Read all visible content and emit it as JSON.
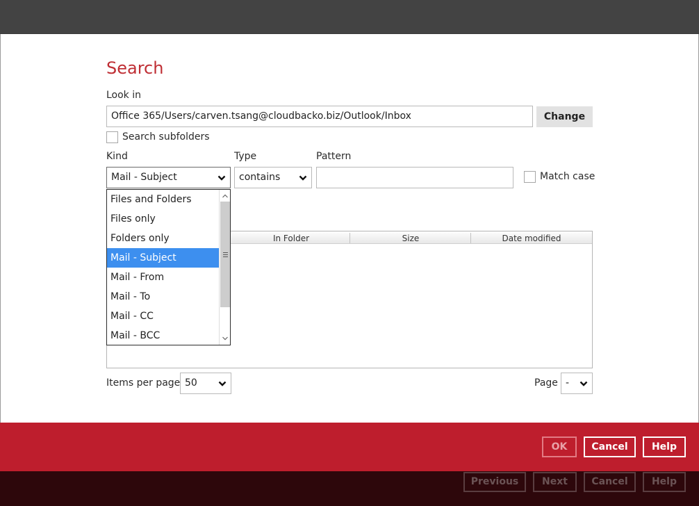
{
  "dialog": {
    "title": "Search"
  },
  "look_in": {
    "label": "Look in",
    "value": "Office 365/Users/carven.tsang@cloudbacko.biz/Outlook/Inbox",
    "change_label": "Change"
  },
  "search_subfolders": {
    "label": "Search subfolders",
    "checked": false
  },
  "kind": {
    "label": "Kind",
    "selected": "Mail - Subject",
    "options": [
      "Files and Folders",
      "Files only",
      "Folders only",
      "Mail - Subject",
      "Mail - From",
      "Mail - To",
      "Mail - CC",
      "Mail - BCC"
    ],
    "selected_index": 3
  },
  "type": {
    "label": "Type",
    "selected": "contains"
  },
  "pattern": {
    "label": "Pattern",
    "value": ""
  },
  "match_case": {
    "label": "Match case",
    "checked": false
  },
  "results_table": {
    "columns": [
      "In Folder",
      "Size",
      "Date modified"
    ]
  },
  "pagination": {
    "items_per_page_label": "Items per page",
    "items_per_page_value": "50",
    "page_label": "Page",
    "page_value": "-"
  },
  "dialog_buttons": {
    "ok": "OK",
    "cancel": "Cancel",
    "help": "Help"
  },
  "wizard_buttons": {
    "previous": "Previous",
    "next": "Next",
    "cancel": "Cancel",
    "help": "Help"
  },
  "icons": {
    "dropdown": "chevron-down-icon",
    "scroll_up": "chevron-up-icon",
    "scroll_down": "chevron-down-icon",
    "scroll_grip": "grip-icon"
  },
  "colors": {
    "title_red": "#bf2e34",
    "footer_red": "#be1e2d",
    "footer_dark": "#2d070b",
    "selection_blue": "#3d8fef"
  }
}
